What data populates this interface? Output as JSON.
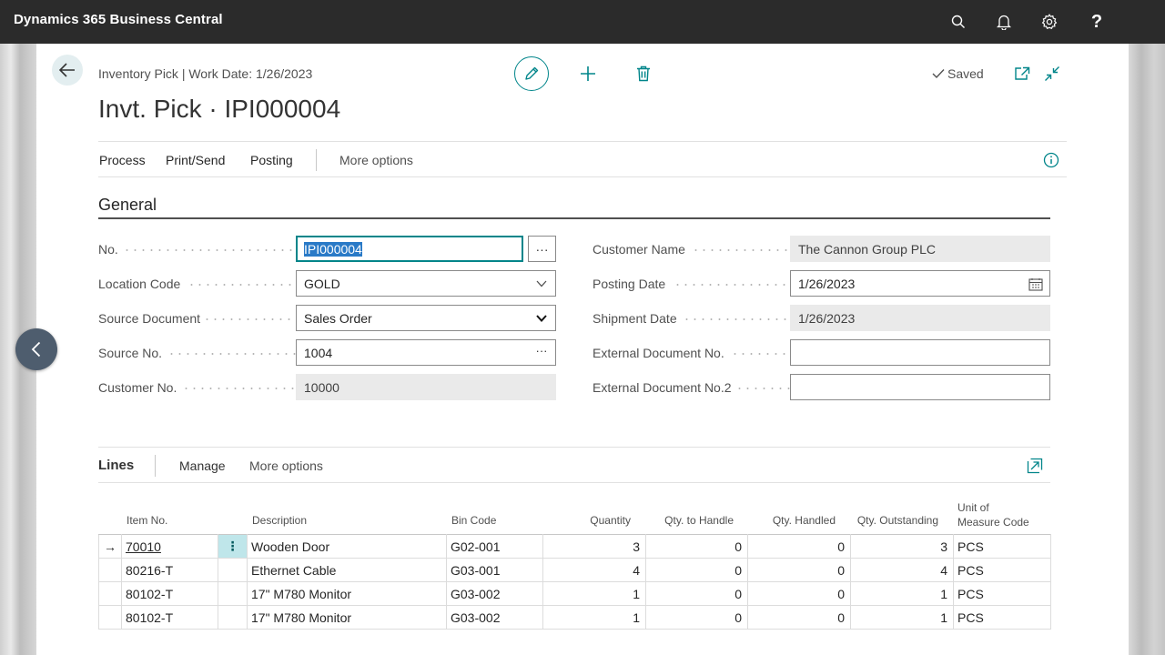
{
  "app": {
    "title": "Dynamics 365 Business Central",
    "icons": [
      "search-icon",
      "bell-icon",
      "gear-icon",
      "help-icon"
    ]
  },
  "header": {
    "breadcrumb": "Inventory Pick | Work Date: 1/26/2023",
    "title": "Invt. Pick · IPI000004",
    "saved_label": "Saved",
    "icons": [
      "back-arrow-icon",
      "pencil-icon",
      "plus-icon",
      "trash-icon",
      "check-icon",
      "open-new-window-icon",
      "collapse-icon"
    ]
  },
  "actions": {
    "items": [
      "Process",
      "Print/Send",
      "Posting"
    ],
    "more": "More options",
    "info_icon": "info-icon"
  },
  "general": {
    "title": "General",
    "left_fields": [
      {
        "label": "No.",
        "value": "IPI000004"
      },
      {
        "label": "Location Code",
        "value": "GOLD"
      },
      {
        "label": "Source Document",
        "value": "Sales Order"
      },
      {
        "label": "Source No.",
        "value": "1004"
      },
      {
        "label": "Customer No.",
        "value": "10000"
      }
    ],
    "right_fields": [
      {
        "label": "Customer Name",
        "value": "The Cannon Group PLC"
      },
      {
        "label": "Posting Date",
        "value": "1/26/2023"
      },
      {
        "label": "Shipment Date",
        "value": "1/26/2023"
      },
      {
        "label": "External Document No.",
        "value": ""
      },
      {
        "label": "External Document No.2",
        "value": ""
      }
    ],
    "assist_button": "···"
  },
  "lines": {
    "title": "Lines",
    "manage": "Manage",
    "more": "More options",
    "columns": {
      "item_no": "Item No.",
      "description": "Description",
      "bin_code": "Bin Code",
      "quantity": "Quantity",
      "qty_to_handle": "Qty. to Handle",
      "qty_handled": "Qty. Handled",
      "qty_outstanding": "Qty. Outstanding",
      "uom_line1": "Unit of",
      "uom_line2": "Measure Code"
    },
    "rows": [
      {
        "item_no": "70010",
        "description": "Wooden Door",
        "bin_code": "G02-001",
        "quantity": "3",
        "qty_to_handle": "0",
        "qty_handled": "0",
        "qty_outstanding": "3",
        "uom": "PCS"
      },
      {
        "item_no": "80216-T",
        "description": "Ethernet Cable",
        "bin_code": "G03-001",
        "quantity": "4",
        "qty_to_handle": "0",
        "qty_handled": "0",
        "qty_outstanding": "4",
        "uom": "PCS"
      },
      {
        "item_no": "80102-T",
        "description": "17\" M780 Monitor",
        "bin_code": "G03-002",
        "quantity": "1",
        "qty_to_handle": "0",
        "qty_handled": "0",
        "qty_outstanding": "1",
        "uom": "PCS"
      },
      {
        "item_no": "80102-T",
        "description": "17\" M780 Monitor",
        "bin_code": "G03-002",
        "quantity": "1",
        "qty_to_handle": "0",
        "qty_handled": "0",
        "qty_outstanding": "1",
        "uom": "PCS"
      }
    ],
    "current_row_marker": "→",
    "row_menu": "⋮"
  },
  "colors": {
    "accent": "#00858a",
    "topbar": "#2b2b2b",
    "readonly_field": "#eaeaea",
    "side_nav": "#4e5d6e"
  }
}
